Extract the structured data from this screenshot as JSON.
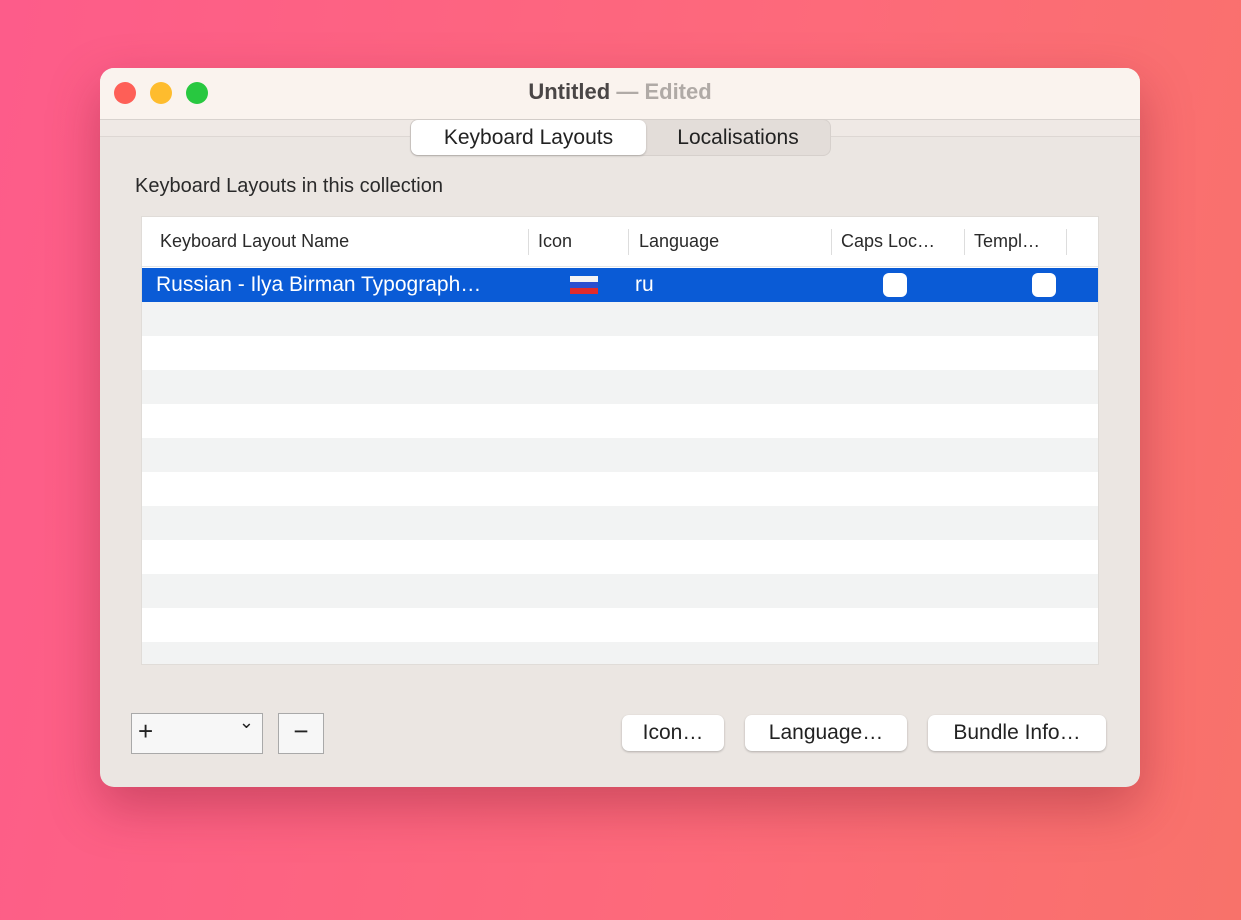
{
  "window": {
    "title": "Untitled",
    "separator": "—",
    "status": "Edited"
  },
  "tabs": [
    {
      "label": "Keyboard Layouts",
      "selected": true
    },
    {
      "label": "Localisations",
      "selected": false
    }
  ],
  "section_heading": "Keyboard Layouts in this collection",
  "table": {
    "columns": [
      "Keyboard Layout Name",
      "Icon",
      "Language",
      "Caps Loc…",
      "Templ…"
    ],
    "rows": [
      {
        "name": "Russian - Ilya Birman Typograph…",
        "icon": "russian-flag-icon",
        "language": "ru",
        "caps_lock": false,
        "template": false,
        "selected": true
      }
    ]
  },
  "controls": {
    "add": "+",
    "remove": "−",
    "chevron": "⌄"
  },
  "buttons": {
    "icon": "Icon…",
    "language": "Language…",
    "bundle_info": "Bundle Info…"
  },
  "colors": {
    "selection": "#0a5bd6",
    "close": "#fe5f57",
    "minimize": "#febc2e",
    "zoom": "#28c840"
  }
}
